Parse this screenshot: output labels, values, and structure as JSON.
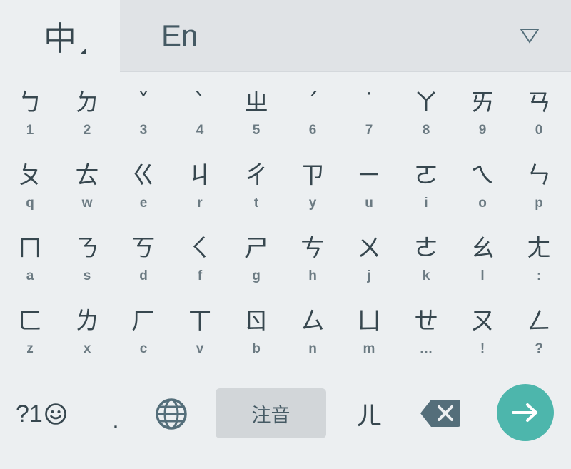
{
  "topbar": {
    "zh_tab_label": "中",
    "en_tab_label": "En",
    "dropdown_icon": "triangle-down-icon"
  },
  "rows": [
    {
      "keys": [
        {
          "main": "ㄅ",
          "sub": "1"
        },
        {
          "main": "ㄉ",
          "sub": "2"
        },
        {
          "main": "ˇ",
          "sub": "3"
        },
        {
          "main": "ˋ",
          "sub": "4"
        },
        {
          "main": "ㄓ",
          "sub": "5"
        },
        {
          "main": "ˊ",
          "sub": "6"
        },
        {
          "main": "˙",
          "sub": "7"
        },
        {
          "main": "ㄚ",
          "sub": "8"
        },
        {
          "main": "ㄞ",
          "sub": "9"
        },
        {
          "main": "ㄢ",
          "sub": "0"
        }
      ]
    },
    {
      "keys": [
        {
          "main": "ㄆ",
          "sub": "q"
        },
        {
          "main": "ㄊ",
          "sub": "w"
        },
        {
          "main": "ㄍ",
          "sub": "e"
        },
        {
          "main": "ㄐ",
          "sub": "r"
        },
        {
          "main": "ㄔ",
          "sub": "t"
        },
        {
          "main": "ㄗ",
          "sub": "y"
        },
        {
          "main": "ㄧ",
          "sub": "u"
        },
        {
          "main": "ㄛ",
          "sub": "i"
        },
        {
          "main": "ㄟ",
          "sub": "o"
        },
        {
          "main": "ㄣ",
          "sub": "p"
        }
      ]
    },
    {
      "keys": [
        {
          "main": "ㄇ",
          "sub": "a"
        },
        {
          "main": "ㄋ",
          "sub": "s"
        },
        {
          "main": "ㄎ",
          "sub": "d"
        },
        {
          "main": "ㄑ",
          "sub": "f"
        },
        {
          "main": "ㄕ",
          "sub": "g"
        },
        {
          "main": "ㄘ",
          "sub": "h"
        },
        {
          "main": "ㄨ",
          "sub": "j"
        },
        {
          "main": "ㄜ",
          "sub": "k"
        },
        {
          "main": "ㄠ",
          "sub": "l"
        },
        {
          "main": "ㄤ",
          "sub": ":"
        }
      ]
    },
    {
      "keys": [
        {
          "main": "ㄈ",
          "sub": "z"
        },
        {
          "main": "ㄌ",
          "sub": "x"
        },
        {
          "main": "ㄏ",
          "sub": "c"
        },
        {
          "main": "ㄒ",
          "sub": "v"
        },
        {
          "main": "ㄖ",
          "sub": "b"
        },
        {
          "main": "ㄙ",
          "sub": "n"
        },
        {
          "main": "ㄩ",
          "sub": "m"
        },
        {
          "main": "ㄝ",
          "sub": "…"
        },
        {
          "main": "ㄡ",
          "sub": "!"
        },
        {
          "main": "ㄥ",
          "sub": "?"
        }
      ]
    }
  ],
  "bottom": {
    "symbols_label": "?1",
    "smiley_icon": "smiley-icon",
    "period_label": ".",
    "globe_icon": "globe-icon",
    "space_label": "注音",
    "er_label": "ㄦ",
    "backspace_icon": "backspace-icon",
    "enter_icon": "arrow-right-icon",
    "enter_color": "#4db6ac"
  }
}
